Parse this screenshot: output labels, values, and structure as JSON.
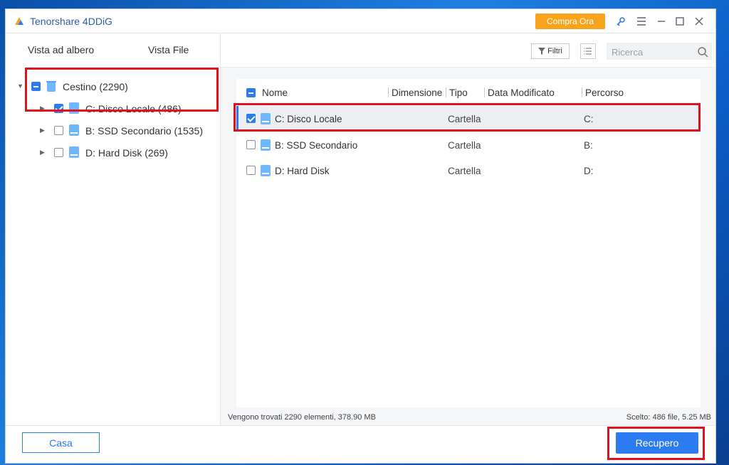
{
  "app": {
    "title": "Tenorshare 4DDiG",
    "buy_label": "Compra Ora"
  },
  "colors": {
    "accent": "#2d7bf0",
    "buy": "#f7a31c",
    "highlight": "#e2101a"
  },
  "sidebar": {
    "tabs": [
      {
        "label": "Vista ad albero"
      },
      {
        "label": "Vista File"
      }
    ],
    "tree": {
      "root": {
        "label": "Cestino (2290)",
        "state": "partial"
      },
      "children": [
        {
          "label": "C: Disco Locale (486)",
          "checked": true
        },
        {
          "label": "B: SSD Secondario (1535)",
          "checked": false
        },
        {
          "label": "D: Hard Disk (269)",
          "checked": false
        }
      ]
    }
  },
  "toolbar": {
    "filter_label": "Filtri",
    "search_placeholder": "Ricerca"
  },
  "file_list": {
    "columns": [
      "Nome",
      "Dimensione",
      "Tipo",
      "Data Modificato",
      "Percorso"
    ],
    "rows": [
      {
        "name": "C: Disco Locale",
        "type": "Cartella",
        "path": "C:",
        "checked": true,
        "selected": true
      },
      {
        "name": "B: SSD Secondario",
        "type": "Cartella",
        "path": "B:",
        "checked": false,
        "selected": false
      },
      {
        "name": "D: Hard Disk",
        "type": "Cartella",
        "path": "D:",
        "checked": false,
        "selected": false
      }
    ]
  },
  "status": {
    "found": "Vengono trovati 2290 elementi, 378.90 MB",
    "selected": "Scelto: 486 file, 5.25 MB"
  },
  "footer": {
    "home_label": "Casa",
    "recover_label": "Recupero"
  }
}
